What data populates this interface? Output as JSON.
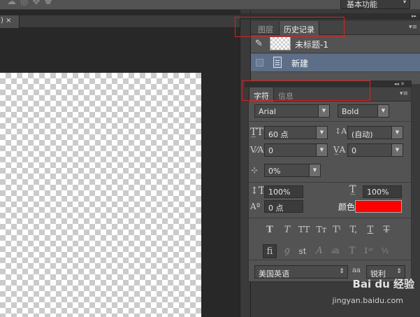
{
  "topbar": {
    "workspace": "基本功能",
    "workspace_arrow": "▾"
  },
  "document": {
    "tab_close": ") ×"
  },
  "history": {
    "tabs": [
      {
        "label": "图层",
        "active": false
      },
      {
        "label": "历史记录",
        "active": true
      }
    ],
    "snapshot": "未标题-1",
    "entry": "新建"
  },
  "character": {
    "tabs": [
      {
        "label": "字符",
        "active": true
      },
      {
        "label": "信息",
        "active": false
      }
    ],
    "font_family": "Arial",
    "font_style": "Bold",
    "size": "60 点",
    "leading": "(自动)",
    "kerning": "0",
    "tracking": "0",
    "tsume": "0%",
    "vscale": "100%",
    "hscale": "100%",
    "baseline": "0 点",
    "color_label": "颜色：",
    "color": "#ff0000",
    "language": "美国英语",
    "antialias_icon": "aa",
    "antialias": "锐利"
  },
  "watermark": {
    "brand": "Bai du 经验",
    "url": "jingyan.baidu.com"
  }
}
